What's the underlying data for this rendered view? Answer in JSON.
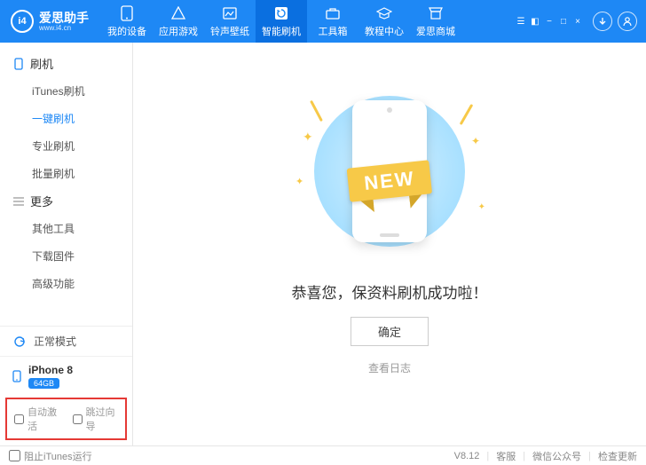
{
  "brand": {
    "badge": "i4",
    "name": "爱思助手",
    "site": "www.i4.cn"
  },
  "nav": [
    {
      "label": "我的设备"
    },
    {
      "label": "应用游戏"
    },
    {
      "label": "铃声壁纸"
    },
    {
      "label": "智能刷机"
    },
    {
      "label": "工具箱"
    },
    {
      "label": "教程中心"
    },
    {
      "label": "爱思商城"
    }
  ],
  "nav_active_index": 3,
  "sidebar": {
    "group_flash": "刷机",
    "flash_items": [
      "iTunes刷机",
      "一键刷机",
      "专业刷机",
      "批量刷机"
    ],
    "flash_active_index": 1,
    "group_more": "更多",
    "more_items": [
      "其他工具",
      "下载固件",
      "高级功能"
    ],
    "mode": "正常模式",
    "device": {
      "name": "iPhone 8",
      "storage": "64GB"
    },
    "auto_activate": "自动激活",
    "skip_wizard": "跳过向导"
  },
  "main": {
    "ribbon": "NEW",
    "success": "恭喜您，保资料刷机成功啦！",
    "ok": "确定",
    "view_log": "查看日志"
  },
  "status": {
    "block_itunes": "阻止iTunes运行",
    "version": "V8.12",
    "support": "客服",
    "wechat": "微信公众号",
    "update": "检查更新"
  }
}
